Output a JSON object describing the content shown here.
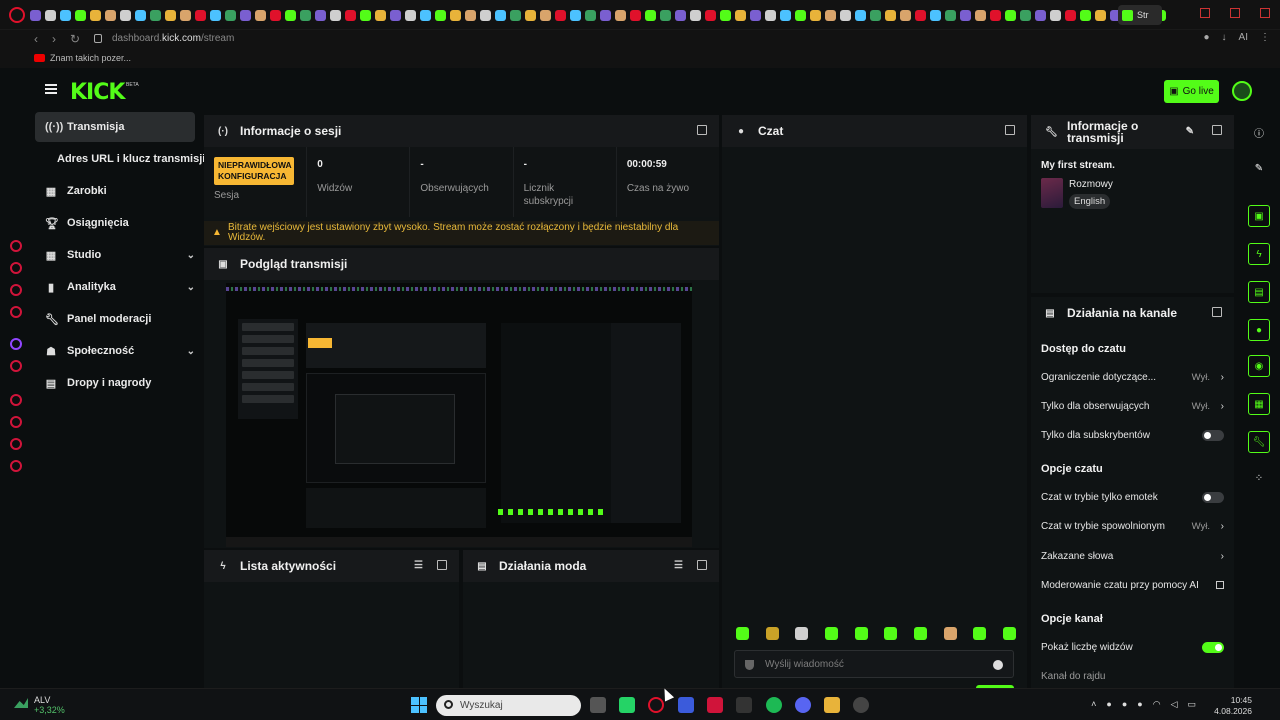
{
  "browser": {
    "active_tab_label": "Str",
    "url_prefix": "dashboard.",
    "url_domain": "kick.com",
    "url_path": "/stream",
    "bookmark_label": "Znam takich pozer...",
    "aria_label": "AI"
  },
  "header": {
    "logo_text": "KICK",
    "beta_label": "BETA",
    "go_live_label": "Go live"
  },
  "nav": {
    "items": [
      {
        "label": "Transmisja",
        "icon": "broadcast-icon",
        "active": true
      },
      {
        "label": "Zarobki",
        "icon": "earnings-icon"
      },
      {
        "label": "Osiągnięcia",
        "icon": "trophy-icon"
      },
      {
        "label": "Studio",
        "icon": "studio-icon",
        "expandable": true
      },
      {
        "label": "Analityka",
        "icon": "analytics-icon",
        "expandable": true
      },
      {
        "label": "Panel moderacji",
        "icon": "wrench-icon"
      },
      {
        "label": "Społeczność",
        "icon": "community-icon",
        "expandable": true
      },
      {
        "label": "Dropy i nagrody",
        "icon": "drops-icon"
      }
    ],
    "sub_item": "Adres URL i klucz transmisji"
  },
  "session": {
    "title": "Informacje o sesji",
    "badge": "NIEPRAWIDŁOWA KONFIGURACJA",
    "session_label": "Sesja",
    "viewers_value": "0",
    "viewers_label": "Widzów",
    "followers_value": "-",
    "followers_label": "Obserwujących",
    "subs_value": "-",
    "subs_label": "Licznik subskrypcji",
    "time_value": "00:00:59",
    "time_label": "Czas na żywo",
    "warning": "Bitrate wejściowy jest ustawiony zbyt wysoko. Stream może zostać rozłączony i będzie niestabilny dla Widzów."
  },
  "preview": {
    "title": "Podgląd transmisji"
  },
  "activity": {
    "title": "Lista aktywności"
  },
  "mod_actions": {
    "title": "Działania moda"
  },
  "chat": {
    "title": "Czat",
    "placeholder": "Wyślij wiadomość"
  },
  "stream_info": {
    "title": "Informacje o transmisji",
    "stream_title": "My first stream.",
    "category": "Rozmowy",
    "language": "English"
  },
  "channel_actions": {
    "title": "Działania na kanale",
    "chat_access_heading": "Dostęp do czatu",
    "age_restriction": "Ograniczenie dotyczące...",
    "age_restriction_value": "Wył.",
    "followers_only": "Tylko dla obserwujących",
    "followers_only_value": "Wył.",
    "subs_only": "Tylko dla subskrybentów",
    "chat_options_heading": "Opcje czatu",
    "emote_only": "Czat w trybie tylko emotek",
    "slow_mode": "Czat w trybie spowolnionym",
    "slow_mode_value": "Wył.",
    "banned_words": "Zakazane słowa",
    "ai_moderation": "Moderowanie czatu przy pomocy AI",
    "channel_options_heading": "Opcje kanał",
    "show_viewers": "Pokaż liczbę widzów",
    "raid_channel": "Kanał do rajdu"
  },
  "taskbar": {
    "ticker": "ALV",
    "ticker_change": "+3,32%",
    "search_placeholder": "Wyszukaj",
    "time": "10:45",
    "date": "4.08.2026"
  },
  "colors": {
    "accent": "#53fc18",
    "warning": "#f7b733",
    "background": "#0b0e0f",
    "panel": "#0f1314"
  }
}
